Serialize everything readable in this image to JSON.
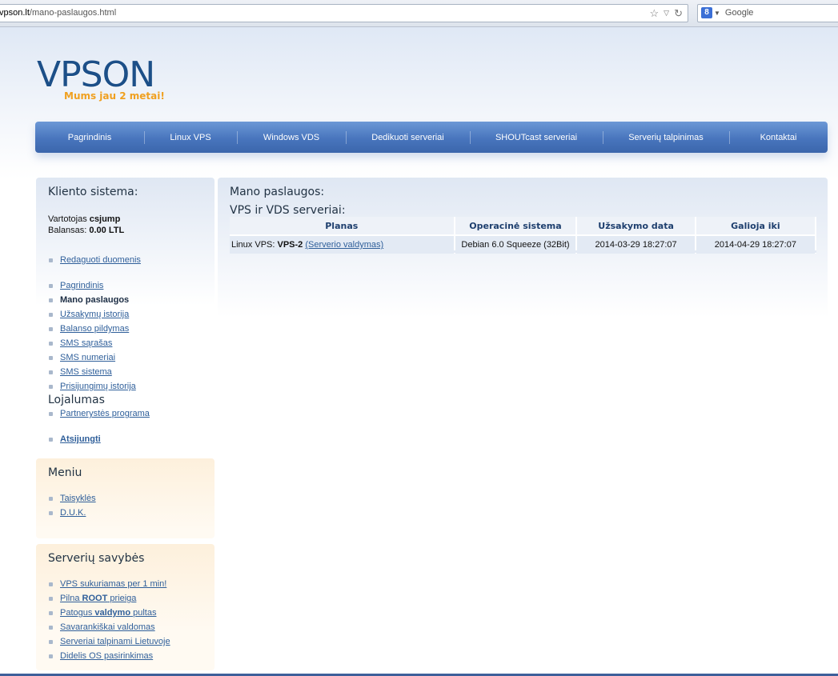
{
  "browser": {
    "url_host": "vpson.lt",
    "url_path": "/mano-paslaugos.html",
    "search_placeholder": "Google",
    "search_engine_icon": "8"
  },
  "logo": {
    "name": "VPSON",
    "tagline": "Mums jau 2 metai!"
  },
  "nav": {
    "items": [
      "Pagrindinis",
      "Linux VPS",
      "Windows VDS",
      "Dedikuoti serveriai",
      "SHOUTcast serveriai",
      "Serverių talpinimas",
      "Kontaktai"
    ]
  },
  "client": {
    "title": "Kliento sistema:",
    "user_label": "Vartotojas",
    "user_value": "csjump",
    "balance_label": "Balansas:",
    "balance_value": "0.00 LTL",
    "edit_link": "Redaguoti duomenis",
    "links": [
      "Pagrindinis",
      "Mano paslaugos",
      "Užsakymų istorija",
      "Balanso pildymas",
      "SMS sąrašas",
      "SMS numeriai",
      "SMS sistema",
      "Prisijungimų istorija"
    ],
    "loyalty_title": "Lojalumas",
    "loyalty_link": "Partnerystės programa",
    "logout": "Atsijungti"
  },
  "meniu": {
    "title": "Meniu",
    "links": [
      "Taisyklės",
      "D.U.K."
    ]
  },
  "savybes": {
    "title": "Serverių savybės",
    "links": [
      {
        "before": "VPS sukuriamas per 1 min!",
        "bold": "",
        "after": ""
      },
      {
        "before": "Pilna ",
        "bold": "ROOT",
        "after": " prieiga"
      },
      {
        "before": "Patogus ",
        "bold": "valdymo",
        "after": " pultas"
      },
      {
        "before": "Savarankiškai valdomas",
        "bold": "",
        "after": ""
      },
      {
        "before": "Serveriai talpinami Lietuvoje",
        "bold": "",
        "after": ""
      },
      {
        "before": "Didelis OS pasirinkimas",
        "bold": "",
        "after": ""
      }
    ]
  },
  "content": {
    "title": "Mano paslaugos:",
    "subtitle": "VPS ir VDS serveriai:",
    "columns": [
      "Planas",
      "Operacinė sistema",
      "Užsakymo data",
      "Galioja iki"
    ],
    "rows": [
      {
        "plan_prefix": "Linux VPS: ",
        "plan_name": "VPS-2",
        "plan_link": "(Serverio valdymas)",
        "os": "Debian 6.0 Squeeze (32Bit)",
        "ordered": "2014-03-29 18:27:07",
        "valid_until": "2014-04-29 18:27:07"
      }
    ]
  },
  "colors": {
    "nav": "#4875bd",
    "link": "#2f5f9a",
    "logo": "#1c4f88",
    "tagline": "#f0a020"
  }
}
